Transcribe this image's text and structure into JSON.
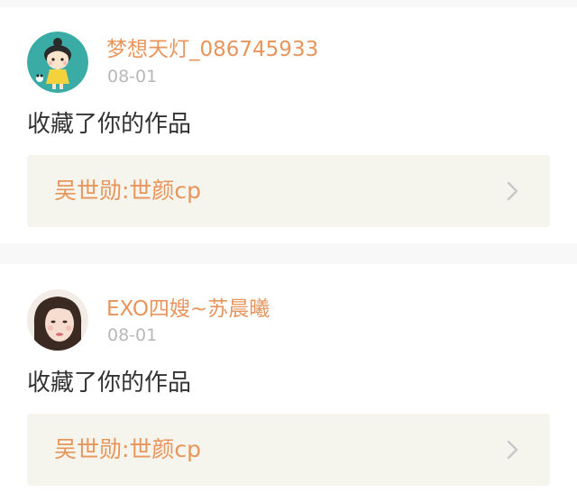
{
  "feed": [
    {
      "username": "梦想天灯_086745933",
      "date": "08-01",
      "action": "收藏了你的作品",
      "work_title": "吴世勋:世颜cp"
    },
    {
      "username": "EXO四嫂~苏晨曦",
      "date": "08-01",
      "action": "收藏了你的作品",
      "work_title": "吴世勋:世颜cp"
    }
  ],
  "colors": {
    "accent": "#e8955c",
    "date": "#b8b8b8",
    "text": "#333333",
    "work_box_bg": "#f5f5ed",
    "page_bg": "#f8f8f8"
  },
  "icons": {
    "chevron": "chevron-right-icon"
  }
}
